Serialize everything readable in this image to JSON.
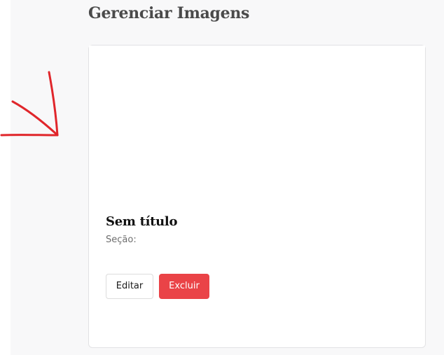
{
  "header": {
    "title": "Gerenciar Imagens"
  },
  "card": {
    "title": "Sem título",
    "section_label": "Seção:",
    "edit_label": "Editar",
    "delete_label": "Excluir"
  },
  "colors": {
    "danger": "#ea4347",
    "annotation": "#e0262b",
    "background": "#f8f8f9"
  },
  "annotation": {
    "icon": "red-arrow-icon"
  }
}
